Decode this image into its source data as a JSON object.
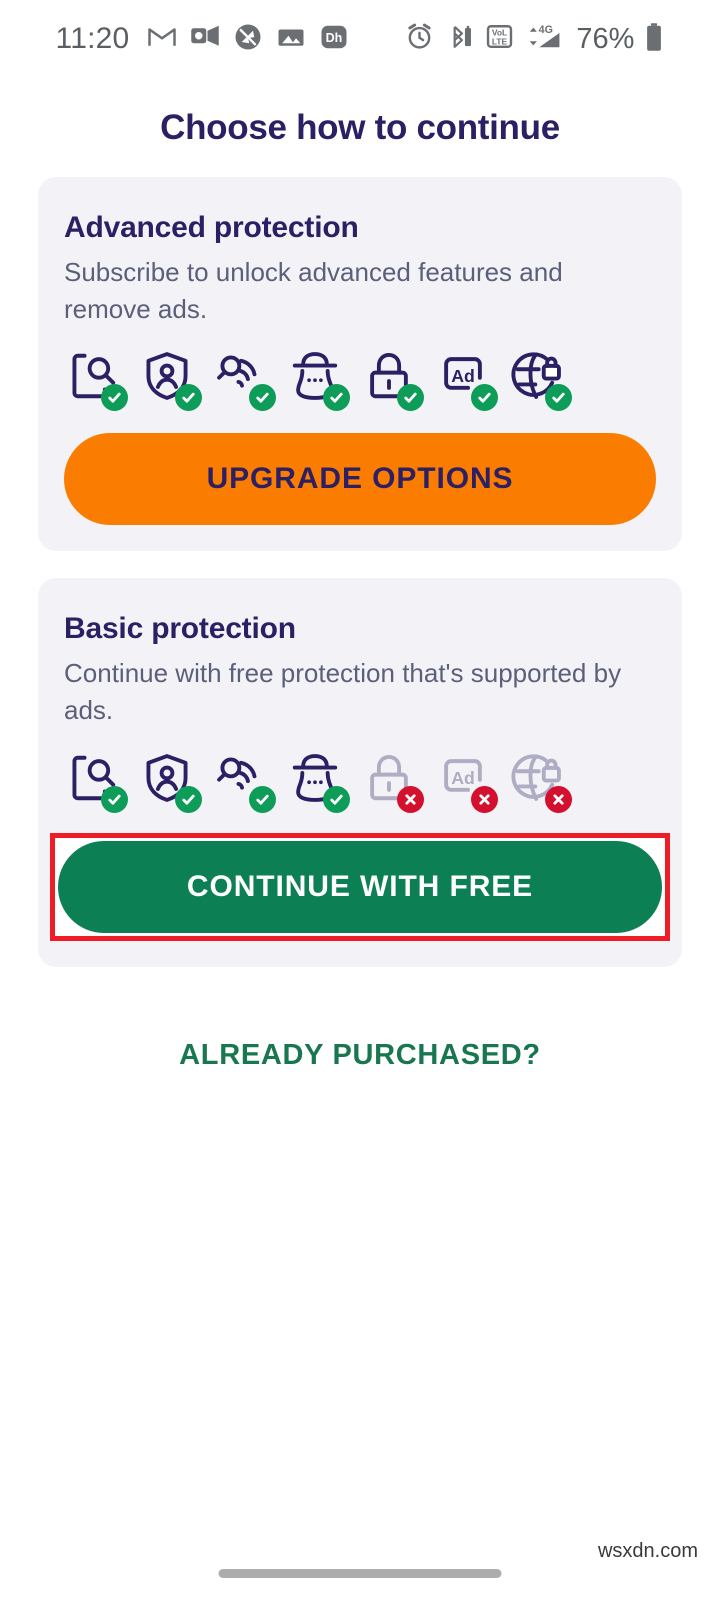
{
  "status_bar": {
    "time": "11:20",
    "battery_percent": "76%",
    "left_icons": [
      {
        "name": "gmail-icon",
        "label": "M"
      },
      {
        "name": "outlook-icon",
        "label": "Outlook"
      },
      {
        "name": "do-not-disturb-icon",
        "label": "Silenced"
      },
      {
        "name": "photos-icon",
        "label": "Photos"
      },
      {
        "name": "disney-plus-hotstar-icon",
        "label": "Dh"
      }
    ],
    "right_icons": [
      {
        "name": "alarm-icon",
        "label": "Alarm set"
      },
      {
        "name": "bluetooth-battery-icon",
        "label": "Bluetooth device battery"
      },
      {
        "name": "volte-icon",
        "label": "VoLTE"
      },
      {
        "name": "mobile-signal-4g-icon",
        "label": "4G"
      },
      {
        "name": "battery-icon",
        "label": "Battery"
      }
    ]
  },
  "page_title": "Choose how to continue",
  "cards": [
    {
      "id": "advanced",
      "title": "Advanced protection",
      "description": "Subscribe to unlock advanced features and remove ads.",
      "features": [
        {
          "name": "device-scan-icon",
          "state": "included"
        },
        {
          "name": "identity-shield-icon",
          "state": "included"
        },
        {
          "name": "wifi-scan-icon",
          "state": "included"
        },
        {
          "name": "hacker-detect-icon",
          "state": "included"
        },
        {
          "name": "lock-icon",
          "state": "included"
        },
        {
          "name": "ad-block-icon",
          "state": "included"
        },
        {
          "name": "vpn-globe-lock-icon",
          "state": "included"
        }
      ],
      "button": {
        "label": "UPGRADE OPTIONS",
        "style": "orange"
      }
    },
    {
      "id": "basic",
      "title": "Basic protection",
      "description": "Continue with free protection that's supported by ads.",
      "features": [
        {
          "name": "device-scan-icon",
          "state": "included"
        },
        {
          "name": "identity-shield-icon",
          "state": "included"
        },
        {
          "name": "wifi-scan-icon",
          "state": "included"
        },
        {
          "name": "hacker-detect-icon",
          "state": "included"
        },
        {
          "name": "lock-icon",
          "state": "excluded"
        },
        {
          "name": "ad-block-icon",
          "state": "excluded"
        },
        {
          "name": "vpn-globe-lock-icon",
          "state": "excluded"
        }
      ],
      "button": {
        "label": "CONTINUE WITH FREE",
        "style": "green",
        "highlighted": true
      }
    }
  ],
  "already_purchased_label": "ALREADY PURCHASED?",
  "watermark": "wsxdn.com",
  "colors": {
    "title_navy": "#2c1f64",
    "card_bg": "#f3f3f7",
    "orange": "#fa7c00",
    "green": "#0c7f55",
    "link_green": "#19774f",
    "badge_ok": "#0e9d58",
    "badge_no": "#d3102e",
    "highlight_red": "#ee1c25",
    "icon_disabled": "#aeadc4"
  }
}
